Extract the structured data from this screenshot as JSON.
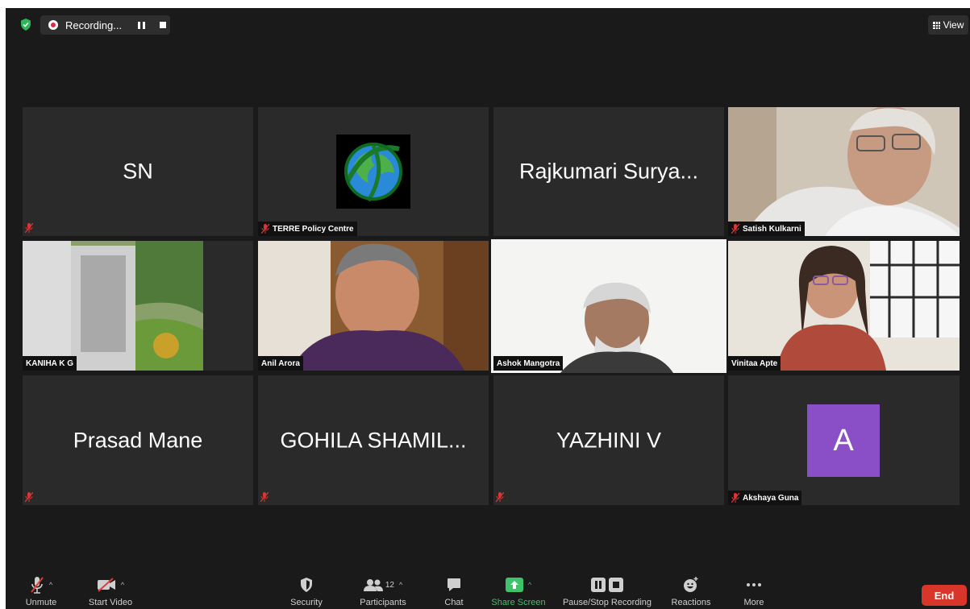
{
  "topbar": {
    "recording_label": "Recording...",
    "view_label": "View"
  },
  "tiles": [
    {
      "big_name": "SN",
      "label": ""
    },
    {
      "big_name": "",
      "label": "TERRE Policy Centre"
    },
    {
      "big_name": "Rajkumari Surya...",
      "label": ""
    },
    {
      "big_name": "",
      "label": "Satish Kulkarni"
    },
    {
      "big_name": "",
      "label": "KANIHA K G"
    },
    {
      "big_name": "",
      "label": "Anil Arora"
    },
    {
      "big_name": "",
      "label": "Ashok Mangotra"
    },
    {
      "big_name": "",
      "label": "Vinitaa Apte"
    },
    {
      "big_name": "Prasad Mane",
      "label": ""
    },
    {
      "big_name": "GOHILA SHAMIL...",
      "label": ""
    },
    {
      "big_name": "YAZHINI V",
      "label": ""
    },
    {
      "big_name": "",
      "label": "Akshaya Guna",
      "avatar_letter": "A"
    }
  ],
  "toolbar": {
    "unmute": "Unmute",
    "start_video": "Start Video",
    "security": "Security",
    "participants": "Participants",
    "participants_count": "12",
    "chat": "Chat",
    "share_screen": "Share Screen",
    "pause_stop_recording": "Pause/Stop Recording",
    "reactions": "Reactions",
    "more": "More",
    "end": "End"
  },
  "colors": {
    "accent_green": "#3ec26a",
    "end_red": "#d9362b",
    "avatar_purple": "#8a4fc7",
    "active_speaker": "#c8dc7a"
  }
}
